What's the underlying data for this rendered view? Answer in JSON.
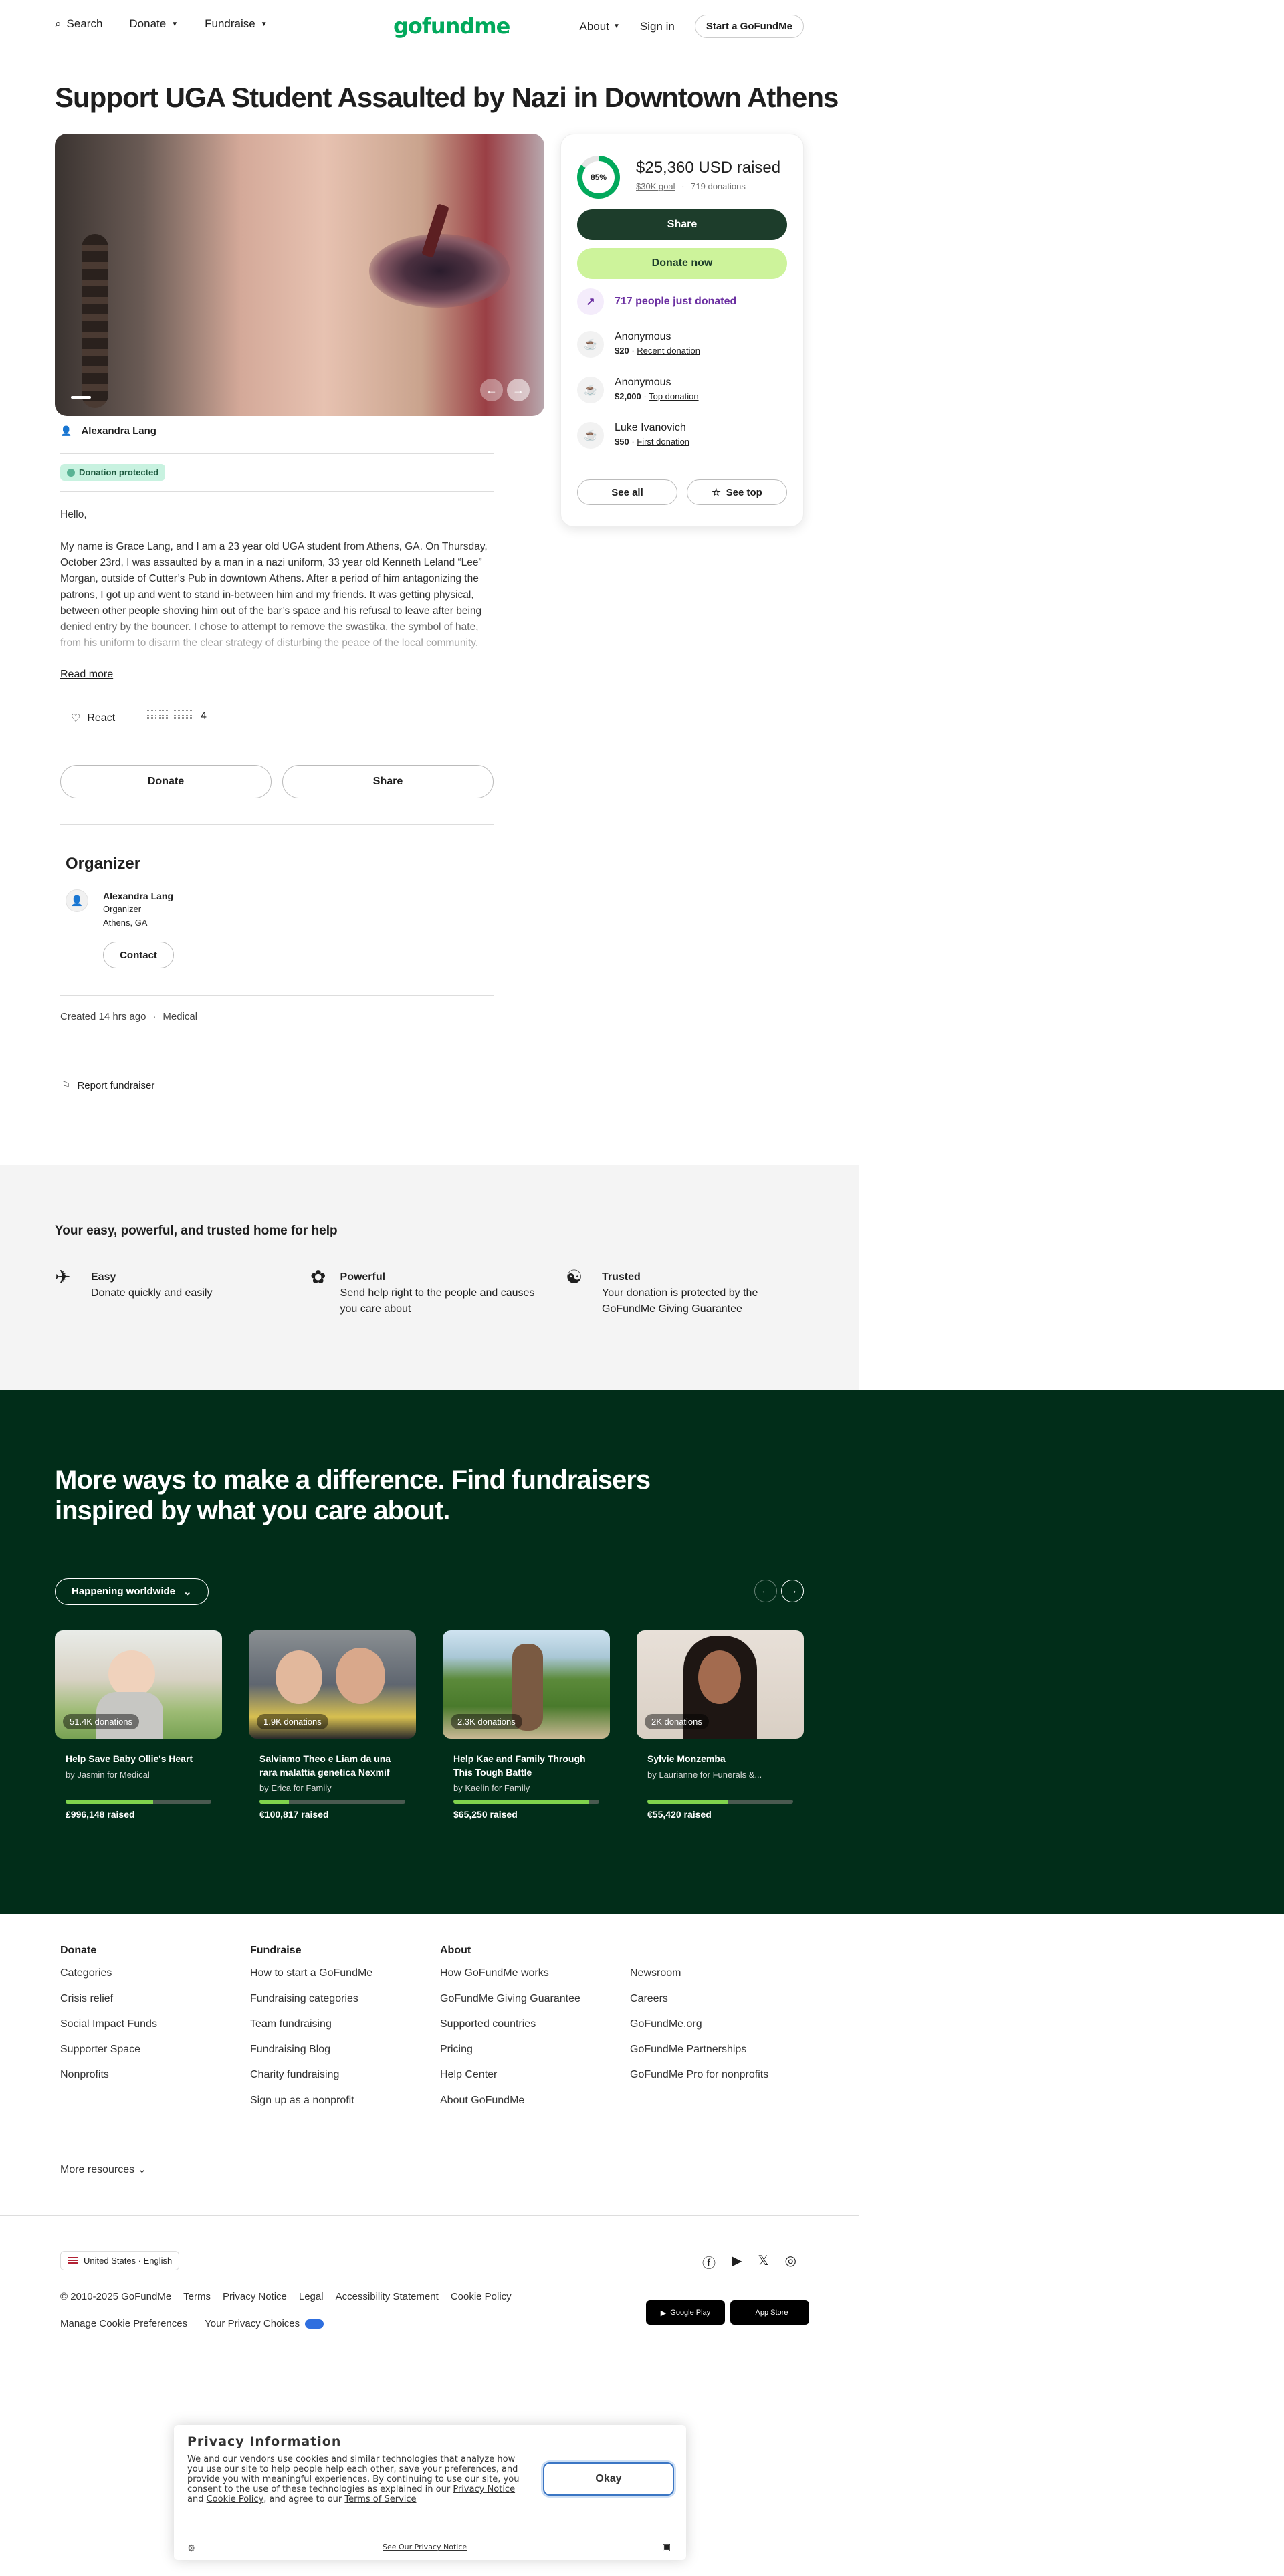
{
  "header": {
    "search_label": "Search",
    "donate_menu": "Donate",
    "fundraise_menu": "Fundraise",
    "logo_text": "gofundme",
    "about_menu": "About",
    "sign_in": "Sign in",
    "start_button": "Start a GoFundMe"
  },
  "campaign": {
    "title": "Support UGA Student Assaulted by Nazi in Downtown Athens",
    "author_name": "Alexandra Lang",
    "protected_badge": "Donation protected",
    "story_greeting": "Hello,",
    "story_body": "My name is Grace Lang, and I am a 23 year old UGA student from Athens, GA. On Thursday, October 23rd, I was assaulted by a man in a nazi uniform, 33 year old Kenneth Leland “Lee” Morgan, outside of Cutter’s Pub in downtown Athens. After a period of him antagonizing the patrons, I got up and went to stand in-between him and my friends. It was getting physical, between other people shoving him out of the bar’s space and his refusal to leave after being denied entry by the bouncer. I chose to attempt to remove the swastika, the symbol of hate, from his uniform to disarm the clear strategy of disturbing the peace of the local community. Within a few seconds of grazing his arm to",
    "read_more": "Read more",
    "react_label": "React",
    "reaction_icons": "🏽 🏽 🏽🏽",
    "reaction_count": "4",
    "donate_button": "Donate",
    "share_button": "Share"
  },
  "organizer": {
    "heading": "Organizer",
    "name": "Alexandra Lang",
    "role": "Organizer",
    "location": "Athens, GA",
    "contact_button": "Contact",
    "created": "Created 14 hrs ago",
    "separator": "·",
    "category": "Medical",
    "report": "Report fundraiser"
  },
  "donation_card": {
    "percent_label": "85%",
    "raised": "$25,360 USD raised",
    "goal": "$30K goal",
    "dot": "·",
    "donations_count": "719 donations",
    "share_button": "Share",
    "donate_now_button": "Donate now",
    "trend_text": "717 people just donated",
    "donors": [
      {
        "name": "Anonymous",
        "amount": "$20",
        "tag": "Recent donation"
      },
      {
        "name": "Anonymous",
        "amount": "$2,000",
        "tag": "Top donation"
      },
      {
        "name": "Luke Ivanovich",
        "amount": "$50",
        "tag": "First donation"
      }
    ],
    "see_all": "See all",
    "see_top": "See top",
    "progress_fraction": 0.85
  },
  "trust": {
    "heading": "Your easy, powerful, and trusted home for help",
    "items": [
      {
        "title": "Easy",
        "text": "Donate quickly and easily"
      },
      {
        "title": "Powerful",
        "text": "Send help right to the people and causes you care about"
      },
      {
        "title": "Trusted",
        "text": "Your donation is protected by the",
        "link": "GoFundMe Giving Guarantee"
      }
    ]
  },
  "discover": {
    "heading": "More ways to make a difference. Find fundraisers inspired by what you care about.",
    "filter": "Happening worldwide",
    "cards": [
      {
        "count": "51.4K donations",
        "title": "Help Save Baby Ollie's Heart",
        "by": "by Jasmin for Medical",
        "raised": "£996,148 raised",
        "progress": 0.6
      },
      {
        "count": "1.9K donations",
        "title": "Salviamo Theo e Liam da una rara malattia genetica Nexmif",
        "by": "by Erica for Family",
        "raised": "€100,817 raised",
        "progress": 0.2
      },
      {
        "count": "2.3K donations",
        "title": "Help Kae and Family Through This Tough Battle",
        "by": "by Kaelin for Family",
        "raised": "$65,250 raised",
        "progress": 0.93
      },
      {
        "count": "2K donations",
        "title": "Sylvie Monzemba",
        "by": "by Laurianne for Funerals &...",
        "raised": "€55,420 raised",
        "progress": 0.55
      }
    ]
  },
  "footer": {
    "columns": [
      {
        "heading": "Donate",
        "items": [
          "Categories",
          "Crisis relief",
          "Social Impact Funds",
          "Supporter Space",
          "Nonprofits"
        ]
      },
      {
        "heading": "Fundraise",
        "items": [
          "How to start a GoFundMe",
          "Fundraising categories",
          "Team fundraising",
          "Fundraising Blog",
          "Charity fundraising",
          "Sign up as a nonprofit"
        ]
      },
      {
        "heading": "About",
        "items": [
          "How GoFundMe works",
          "GoFundMe Giving Guarantee",
          "Supported countries",
          "Pricing",
          "Help Center",
          "About GoFundMe"
        ]
      },
      {
        "heading": "",
        "items": [
          "Newsroom",
          "Careers",
          "GoFundMe.org",
          "GoFundMe Partnerships",
          "GoFundMe Pro for nonprofits"
        ]
      }
    ],
    "more_resources": "More resources",
    "locale": "United States · English",
    "copyright": "© 2010-2025 GoFundMe",
    "legal_links": [
      "Terms",
      "Privacy Notice",
      "Legal",
      "Accessibility Statement",
      "Cookie Policy"
    ],
    "manage_cookies": "Manage Cookie Preferences",
    "privacy_choices": "Your Privacy Choices",
    "google_play": "Google Play",
    "app_store": "App Store"
  },
  "privacy_banner": {
    "title": "Privacy Information",
    "body": "We and our vendors use cookies and similar technologies that analyze how you use our site to help people help each other, save your preferences, and provide you with meaningful experiences. By continuing to use our site, you consent to the use of these technologies as explained in our",
    "privacy_link": "Privacy Notice",
    "and": "and",
    "cookie_link": "Cookie Policy",
    "agree": ", and agree to our",
    "terms_link": "Terms of Service",
    "okay_button": "Okay",
    "see_privacy": "See Our Privacy Notice"
  },
  "colors": {
    "brand_green": "#02a95c",
    "dark_green": "#012d19",
    "button_dark": "#1d3d2b",
    "button_lime": "#cdf39b"
  }
}
